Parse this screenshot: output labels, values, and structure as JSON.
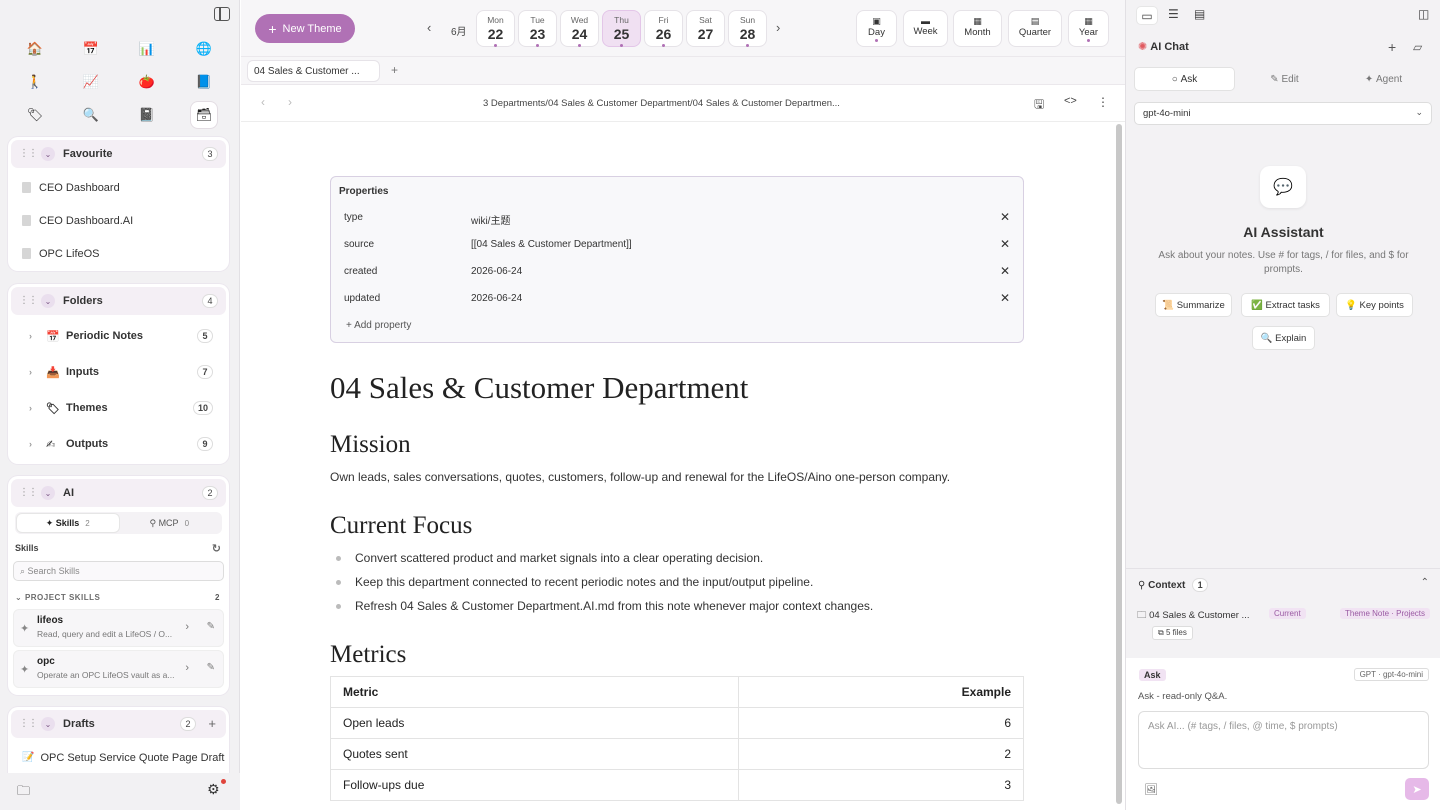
{
  "top": {
    "new_theme": "New Theme",
    "month": "6月",
    "days": [
      {
        "wd": "Mon",
        "dn": "22"
      },
      {
        "wd": "Tue",
        "dn": "23"
      },
      {
        "wd": "Wed",
        "dn": "24"
      },
      {
        "wd": "Thu",
        "dn": "25"
      },
      {
        "wd": "Fri",
        "dn": "26"
      },
      {
        "wd": "Sat",
        "dn": "27"
      },
      {
        "wd": "Sun",
        "dn": "28"
      }
    ],
    "views": [
      "Day",
      "Week",
      "Month",
      "Quarter",
      "Year"
    ]
  },
  "sidebar": {
    "favourite": {
      "title": "Favourite",
      "count": "3",
      "items": [
        "CEO Dashboard",
        "CEO Dashboard.AI",
        "OPC LifeOS"
      ]
    },
    "folders": {
      "title": "Folders",
      "count": "4",
      "items": [
        {
          "label": "Periodic Notes",
          "count": "5",
          "emoji": "📅"
        },
        {
          "label": "Inputs",
          "count": "7",
          "emoji": "📥"
        },
        {
          "label": "Themes",
          "count": "10",
          "emoji": "🏷"
        },
        {
          "label": "Outputs",
          "count": "9",
          "emoji": "✍"
        }
      ]
    },
    "ai": {
      "title": "AI",
      "count": "2",
      "skills_tab": "Skills",
      "skills_count": "2",
      "mcp_tab": "MCP",
      "mcp_count": "0",
      "skills_label": "Skills",
      "search_placeholder": "Search Skills",
      "project_skills": "PROJECT SKILLS",
      "project_count": "2",
      "skills": [
        {
          "name": "lifeos",
          "desc": "Read, query and edit a LifeOS / O..."
        },
        {
          "name": "opc",
          "desc": "Operate an OPC LifeOS vault as a..."
        }
      ]
    },
    "drafts": {
      "title": "Drafts",
      "count": "2",
      "items": [
        "OPC Setup Service Quote Page Draft"
      ]
    }
  },
  "tab": {
    "label": "04 Sales & Customer ..."
  },
  "path": "3 Departments/04 Sales & Customer Department/04 Sales & Customer Departmen...",
  "doc": {
    "props_title": "Properties",
    "props": [
      {
        "k": "type",
        "v": "wiki/主题"
      },
      {
        "k": "source",
        "v": "[[04 Sales & Customer Department]]"
      },
      {
        "k": "created",
        "v": "2026-06-24"
      },
      {
        "k": "updated",
        "v": "2026-06-24"
      }
    ],
    "add_property": "+ Add property",
    "title": "04 Sales & Customer Department",
    "mission_h": "Mission",
    "mission": "Own leads, sales conversations, quotes, customers, follow-up and renewal for the LifeOS/Aino one-person company.",
    "focus_h": "Current Focus",
    "focus": [
      "Convert scattered product and market signals into a clear operating decision.",
      "Keep this department connected to recent periodic notes and the input/output pipeline.",
      "Refresh 04 Sales & Customer Department.AI.md from this note whenever major context changes."
    ],
    "metrics_h": "Metrics",
    "metrics_head": [
      "Metric",
      "Example"
    ],
    "metrics": [
      [
        "Open leads",
        "6"
      ],
      [
        "Quotes sent",
        "2"
      ],
      [
        "Follow-ups due",
        "3"
      ]
    ]
  },
  "right": {
    "title": "AI Chat",
    "modes": [
      "Ask",
      "Edit",
      "Agent"
    ],
    "model": "gpt-4o-mini",
    "assistant_title": "AI Assistant",
    "assistant_desc": "Ask about your notes. Use # for tags, / for files, and $ for prompts.",
    "chips": [
      "Summarize",
      "Extract tasks",
      "Key points",
      "Explain"
    ],
    "context_label": "Context",
    "context_count": "1",
    "context_file": "04 Sales & Customer ...",
    "current": "Current",
    "theme_tag": "Theme Note · Projects",
    "files": "5 files",
    "ask_badge": "Ask",
    "model_badge": "GPT · gpt-4o-mini",
    "ask_desc": "Ask - read-only Q&A.",
    "input_placeholder": "Ask AI... (# tags, / files, @ time, $ prompts)"
  }
}
